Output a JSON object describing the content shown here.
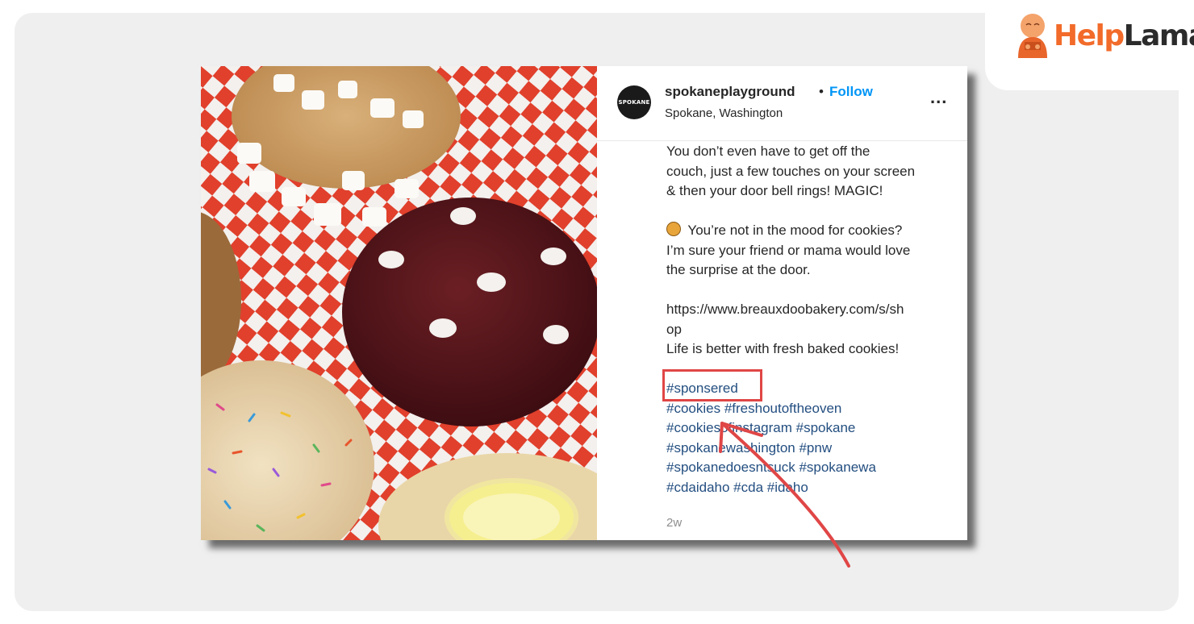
{
  "brand": {
    "logo_part1": "Help",
    "logo_part2": "Lama"
  },
  "post": {
    "avatar_text": "SPOKANE",
    "username": "spokaneplayground",
    "separator": "•",
    "follow_label": "Follow",
    "location": "Spokane, Washington",
    "more_label": "...",
    "caption_lines": [
      "You don’t even have to get off the",
      "couch, just a few touches on your screen",
      "& then your door bell rings! MAGIC!"
    ],
    "caption_lines2": [
      "You’re not in the mood for cookies?",
      "I’m sure your friend or mama would love",
      "the surprise at the door."
    ],
    "link_line1": "https://www.breauxdoobakery.com/s/sh",
    "link_line2": "op",
    "tagline": "Life is better with fresh baked cookies!",
    "highlighted_tag": "#sponsered",
    "hashtag_lines": [
      "#cookies #freshoutoftheoven",
      "#cookiesofinstagram #spokane",
      "#spokanewashington #pnw",
      "#spokanedoesntsuck #spokanewa",
      "#cdaidaho #cda #idaho"
    ],
    "time_ago": "2w"
  },
  "colors": {
    "follow": "#0095f6",
    "hashtag": "#234e80",
    "annotation": "#e04646",
    "brand_orange": "#f26b2a"
  }
}
